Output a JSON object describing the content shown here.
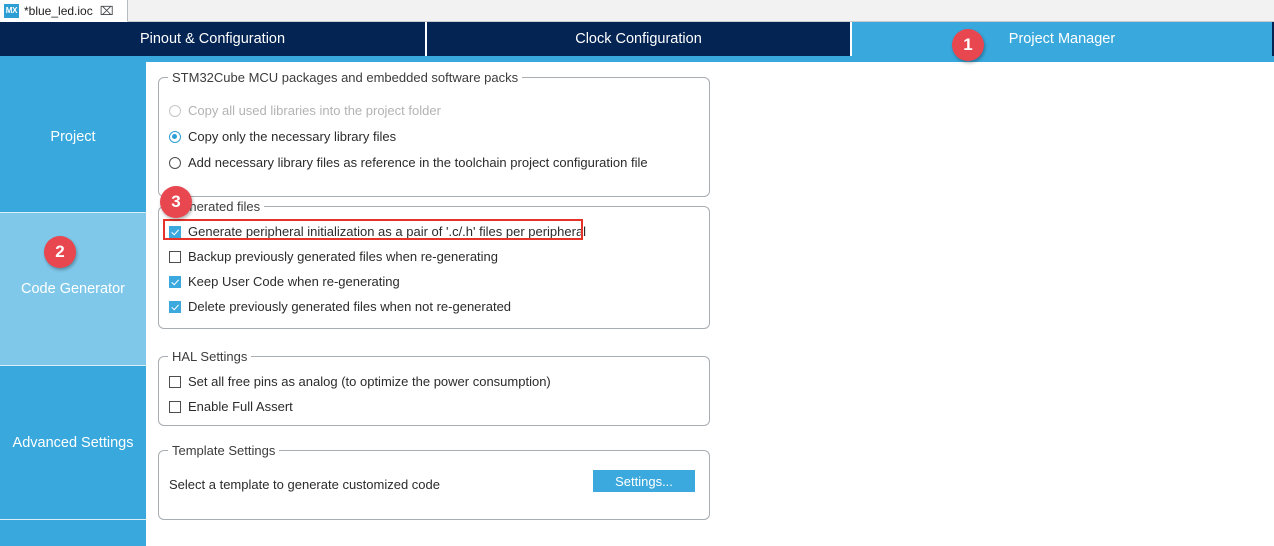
{
  "window": {
    "file_tab": {
      "icon": "mx-logo-icon",
      "icon_text": "MX",
      "title": "*blue_led.ioc",
      "close_glyph": "⌧"
    }
  },
  "ribbon": {
    "tabs": [
      {
        "label": "Pinout & Configuration",
        "active": false
      },
      {
        "label": "Clock Configuration",
        "active": false
      },
      {
        "label": "Project Manager",
        "active": true
      }
    ],
    "active_color": "#39a8dc",
    "inactive_color": "#042454"
  },
  "badges": {
    "step1": "1",
    "step2": "2",
    "step3": "3",
    "color": "#e8474f"
  },
  "sidebar": {
    "items": [
      {
        "label": "Project",
        "selected": false
      },
      {
        "label": "Code Generator",
        "selected": true
      },
      {
        "label": "Advanced Settings",
        "selected": false
      },
      {
        "label": "",
        "selected": false
      }
    ],
    "base_color": "#39a8dc",
    "selected_color": "#7fc8ea"
  },
  "packages_group": {
    "legend": "STM32Cube MCU packages and embedded software packs",
    "options": [
      {
        "label": "Copy all used libraries into the project folder",
        "checked": false,
        "disabled": true
      },
      {
        "label": "Copy only the necessary library files",
        "checked": true,
        "disabled": false
      },
      {
        "label": "Add necessary library files as reference in the toolchain project configuration file",
        "checked": false,
        "disabled": false
      }
    ]
  },
  "generated_files_group": {
    "legend": "Generated files",
    "options": [
      {
        "label": "Generate peripheral initialization as a pair of '.c/.h' files per peripheral",
        "checked": true,
        "highlighted": true
      },
      {
        "label": "Backup previously generated files when re-generating",
        "checked": false,
        "highlighted": false
      },
      {
        "label": "Keep User Code when re-generating",
        "checked": true,
        "highlighted": false
      },
      {
        "label": "Delete previously generated files when not re-generated",
        "checked": true,
        "highlighted": false
      }
    ],
    "highlight_color": "#e63329"
  },
  "hal_settings_group": {
    "legend": "HAL Settings",
    "options": [
      {
        "label": "Set all free pins as analog (to optimize the power consumption)",
        "checked": false
      },
      {
        "label": "Enable Full Assert",
        "checked": false
      }
    ]
  },
  "template_settings_group": {
    "legend": "Template Settings",
    "description": "Select a template to generate customized code",
    "button_label": "Settings...",
    "button_color": "#3ba9dd"
  }
}
